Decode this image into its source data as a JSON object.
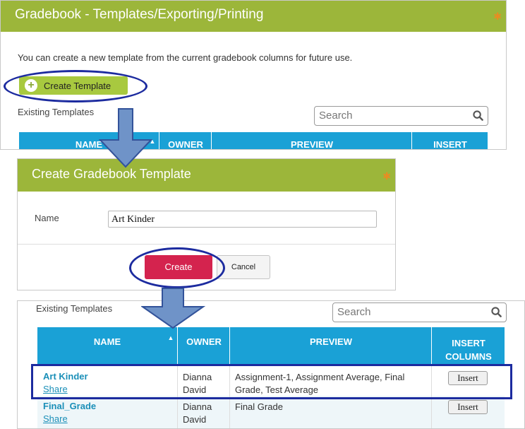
{
  "panel_top": {
    "title": "Gradebook - Templates/Exporting/Printing",
    "description": "You can create a new template from the current gradebook columns for future use.",
    "create_button": "Create Template",
    "existing_label": "Existing Templates",
    "search_placeholder": "Search",
    "columns": [
      "NAME",
      "OWNER",
      "PREVIEW",
      "INSERT"
    ]
  },
  "dialog": {
    "title": "Create Gradebook Template",
    "name_label": "Name",
    "name_value": "Art Kinder",
    "create_button": "Create",
    "cancel_button": "Cancel"
  },
  "panel_bottom": {
    "existing_label": "Existing Templates",
    "search_placeholder": "Search",
    "columns": {
      "name": "NAME",
      "owner": "OWNER",
      "preview": "PREVIEW",
      "insert": "INSERT COLUMNS"
    },
    "rows": [
      {
        "name": "Art Kinder",
        "share": "Share",
        "owner": "Dianna David",
        "preview": "Assignment-1, Assignment Average, Final Grade, Test Average",
        "insert": "Insert"
      },
      {
        "name": "Final_Grade",
        "share": "Share",
        "owner": "Dianna David",
        "preview": "Final Grade",
        "insert": "Insert"
      }
    ]
  },
  "colors": {
    "header_green": "#9cb63a",
    "table_blue": "#1aa1d6",
    "accent_red": "#d4234e",
    "annotation_blue": "#1c2b9f",
    "arrow": "#6f93c8"
  }
}
